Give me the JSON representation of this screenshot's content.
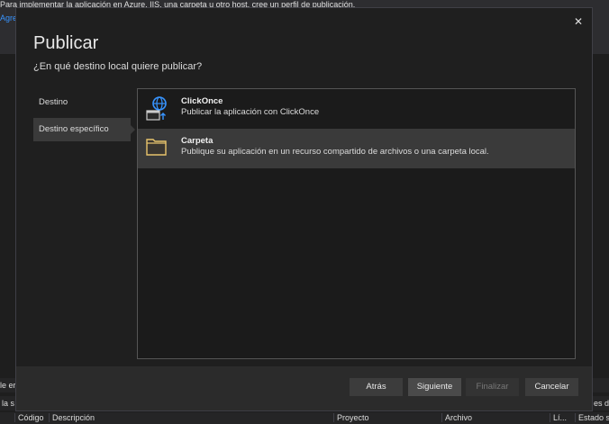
{
  "background": {
    "info_text": "Para implementar la aplicación en Azure, IIS, una carpeta u otro host, cree un perfil de publicación.",
    "link_fragment": "Agre",
    "left_fragment_1": "le er",
    "left_fragment_2": "la s",
    "right_fragment": "es de",
    "table_columns": [
      "Código",
      "Descripción",
      "Proyecto",
      "Archivo",
      "Lí...",
      "Estado s"
    ]
  },
  "dialog": {
    "title": "Publicar",
    "subtitle": "¿En qué destino local quiere publicar?",
    "close_icon": "close-icon",
    "nav": [
      {
        "label": "Destino",
        "selected": false
      },
      {
        "label": "Destino específico",
        "selected": true
      }
    ],
    "options": [
      {
        "name": "ClickOnce",
        "description": "Publicar la aplicación con ClickOnce",
        "icon": "globe-window-icon",
        "selected": false
      },
      {
        "name": "Carpeta",
        "description": "Publique su aplicación en un recurso compartido de archivos o una carpeta local.",
        "icon": "folder-icon",
        "selected": true
      }
    ],
    "buttons": {
      "back": "Atrás",
      "next": "Siguiente",
      "finish": "Finalizar",
      "cancel": "Cancelar"
    },
    "finish_disabled": true
  }
}
